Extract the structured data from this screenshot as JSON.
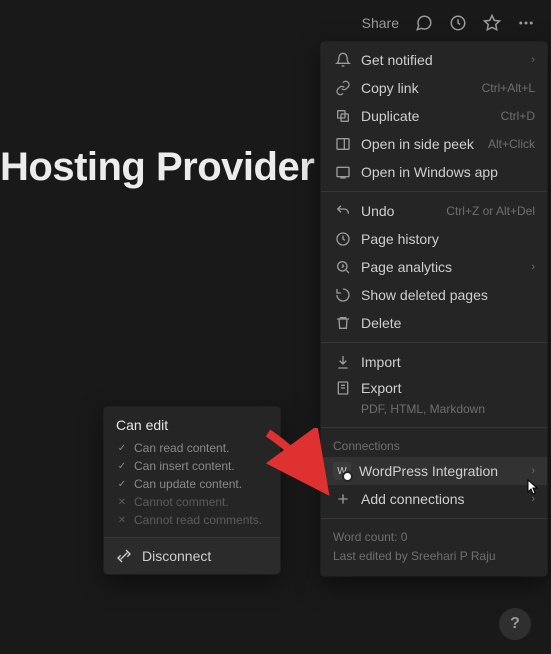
{
  "topbar": {
    "share": "Share"
  },
  "page": {
    "title": "Hosting Provider"
  },
  "menu": {
    "get_notified": "Get notified",
    "copy_link": "Copy link",
    "copy_link_hint": "Ctrl+Alt+L",
    "duplicate": "Duplicate",
    "duplicate_hint": "Ctrl+D",
    "side_peek": "Open in side peek",
    "side_peek_hint": "Alt+Click",
    "windows_app": "Open in Windows app",
    "undo": "Undo",
    "undo_hint": "Ctrl+Z or Alt+Del",
    "page_history": "Page history",
    "page_analytics": "Page analytics",
    "show_deleted": "Show deleted pages",
    "delete": "Delete",
    "import": "Import",
    "export": "Export",
    "export_sub": "PDF, HTML, Markdown",
    "connections_header": "Connections",
    "wordpress": "WordPress Integration",
    "wordpress_badge": "W",
    "add_connections": "Add connections",
    "word_count": "Word count: 0",
    "last_edited": "Last edited by Sreehari P Raju"
  },
  "permissions": {
    "title": "Can edit",
    "items": [
      {
        "allowed": true,
        "text": "Can read content."
      },
      {
        "allowed": true,
        "text": "Can insert content."
      },
      {
        "allowed": true,
        "text": "Can update content."
      },
      {
        "allowed": false,
        "text": "Cannot comment."
      },
      {
        "allowed": false,
        "text": "Cannot read comments."
      }
    ],
    "disconnect": "Disconnect"
  },
  "help": {
    "label": "?"
  }
}
